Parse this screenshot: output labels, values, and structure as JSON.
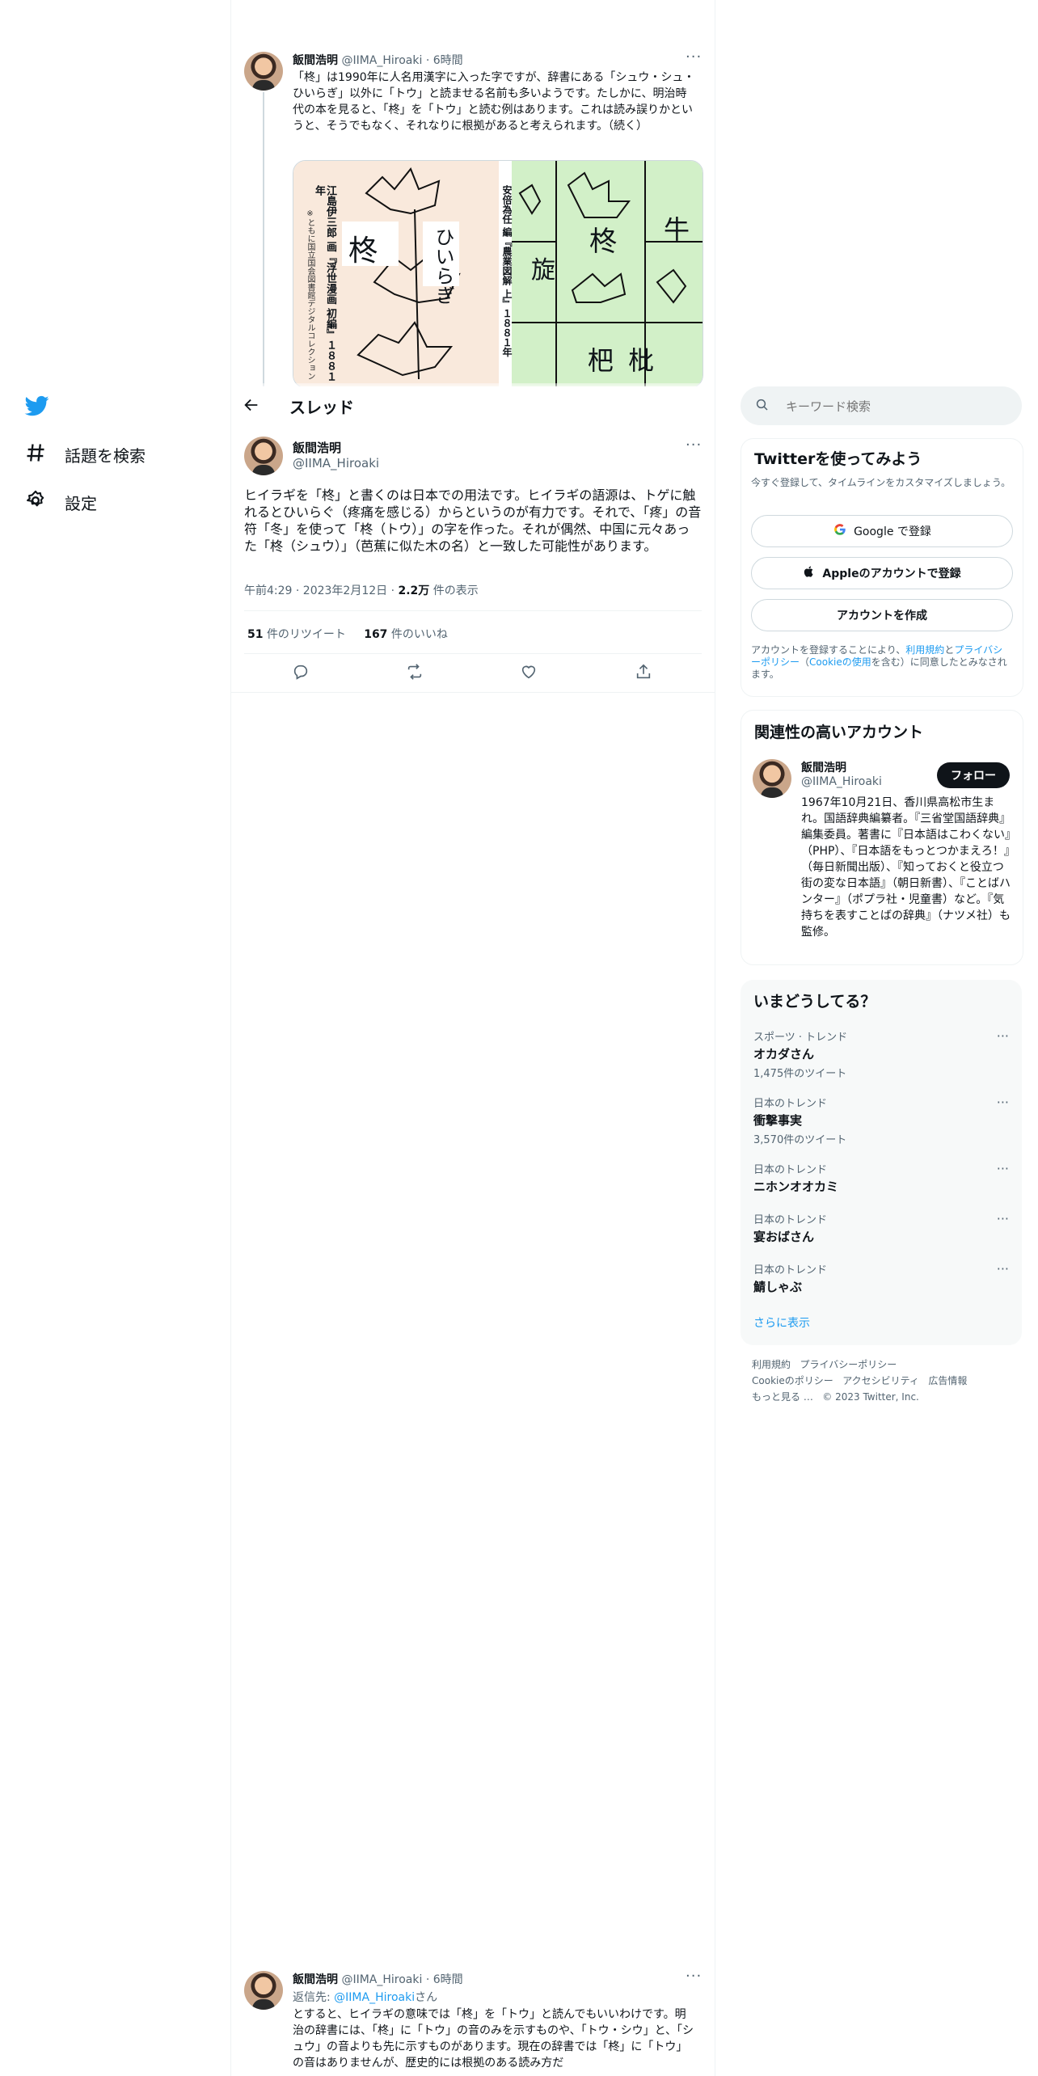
{
  "nav": {
    "logo": "twitter-bird-icon",
    "explore_label": "話題を検索",
    "settings_label": "設定"
  },
  "header": {
    "title": "スレッド"
  },
  "parent_tweet": {
    "name": "飯間浩明",
    "handle": "@IIMA_Hiroaki",
    "time": "· 6時間",
    "text": "「柊」は1990年に人名用漢字に入った字ですが、辞書にある「シュウ・シュ・ひいらぎ」以外に「トウ」と読ませる名前も多いようです。たしかに、明治時代の本を見ると、「柊」を「トウ」と読む例はあります。これは読み誤りかというと、そうでもなく、それなりに根拠があると考えられます。（続く）",
    "image": {
      "left_caption": "江島伊三郎 画『浮世漫画 初編』１８８１年",
      "left_note": "※ともに国立国会図書館デジタルコレクション",
      "left_chars": [
        "柊",
        "ひいらぎ"
      ],
      "right_caption": "安倍為任 編『農業図解 上』１８８１年",
      "right_chars": [
        "旋",
        "柊",
        "牛",
        "杷",
        "枇"
      ]
    }
  },
  "main_tweet": {
    "name": "飯間浩明",
    "handle": "@IIMA_Hiroaki",
    "text": "ヒイラギを「柊」と書くのは日本での用法です。ヒイラギの語源は、トゲに触れるとひいらぐ（疼痛を感じる）からというのが有力です。それで、「疼」の音符「冬」を使って「柊（トウ）」の字を作った。それが偶然、中国に元々あった「柊（シュウ）」（芭蕉に似た木の名）と一致した可能性があります。",
    "time": "午前4:29 · 2023年2月12日 ·",
    "views_count": "2.2万",
    "views_label": "件の表示",
    "retweets_count": "51",
    "retweets_label": "件のリツイート",
    "likes_count": "167",
    "likes_label": "件のいいね"
  },
  "reply_tweet": {
    "name": "飯間浩明",
    "handle": "@IIMA_Hiroaki",
    "time": "· 6時間",
    "reply_prefix": "返信先: ",
    "reply_to": "@IIMA_Hiroaki",
    "reply_suffix": "さん",
    "text": "とすると、ヒイラギの意味では「柊」を「トウ」と読んでもいいわけです。明治の辞書には、「柊」に「トウ」の音のみを示すものや、「トウ・シウ」と、「シュウ」の音よりも先に示すものがあります。現在の辞書では「柊」に「トウ」の音はありませんが、歴史的には根拠のある読み方だ"
  },
  "search": {
    "placeholder": "キーワード検索"
  },
  "signup": {
    "title": "Twitterを使ってみよう",
    "subtitle": "今すぐ登録して、タイムラインをカスタマイズしましょう。",
    "google": "Google で登録",
    "apple": "Appleのアカウントで登録",
    "create": "アカウントを作成",
    "legal_1": "アカウントを登録することにより、",
    "legal_terms": "利用規約",
    "legal_and": "と",
    "legal_privacy": "プライバシーポリシー",
    "legal_paren_open": "（",
    "legal_cookie": "Cookieの使用",
    "legal_2": "を含む）に同意したとみなされます。"
  },
  "relevant": {
    "title": "関連性の高いアカウント",
    "name": "飯間浩明",
    "handle": "@IIMA_Hiroaki",
    "follow": "フォロー",
    "bio": "1967年10月21日、香川県高松市生まれ。国語辞典編纂者。『三省堂国語辞典』編集委員。著書に『日本語はこわくない』（PHP）、『日本語をもっとつかまえろ！』（毎日新聞出版）、『知っておくと役立つ 街の変な日本語』（朝日新書）、『ことばハンター』（ポプラ社・児童書）など。『気持ちを表すことばの辞典』（ナツメ社）も監修。"
  },
  "trends": {
    "title": "いまどうしてる？",
    "items": [
      {
        "category": "スポーツ · トレンド",
        "name": "オカダさん",
        "count": "1,475件のツイート"
      },
      {
        "category": "日本のトレンド",
        "name": "衝撃事実",
        "count": "3,570件のツイート"
      },
      {
        "category": "日本のトレンド",
        "name": "ニホンオオカミ",
        "count": ""
      },
      {
        "category": "日本のトレンド",
        "name": "宴おばさん",
        "count": ""
      },
      {
        "category": "日本のトレンド",
        "name": "鯖しゃぶ",
        "count": ""
      }
    ],
    "show_more": "さらに表示"
  },
  "footer": {
    "terms": "利用規約",
    "privacy": "プライバシーポリシー",
    "cookie": "Cookieのポリシー",
    "accessibility": "アクセシビリティ",
    "ads": "広告情報",
    "more": "もっと見る …",
    "copyright": "© 2023 Twitter, Inc."
  },
  "colors": {
    "accent": "#1d9bf0",
    "text": "#0f1419",
    "muted": "#536471",
    "border": "#eff3f4"
  }
}
